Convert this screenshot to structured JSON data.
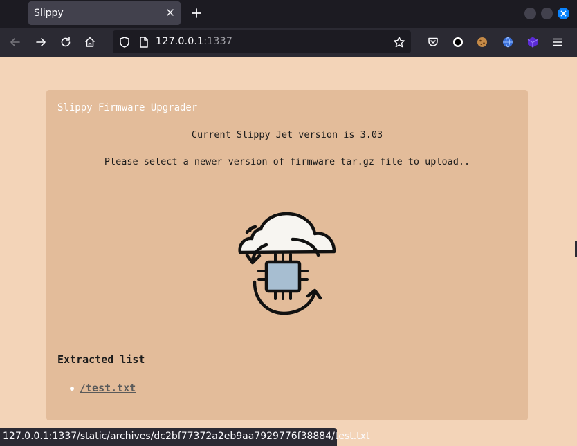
{
  "browser": {
    "tab_title": "Slippy",
    "url_host": "127.0.0.1",
    "url_port": ":1337",
    "status_url": "127.0.0.1:1337/static/archives/dc2bf77372a2eb9aa7929776f38884/test.txt"
  },
  "page": {
    "card_title": "Slippy Firmware Upgrader",
    "current_version_text": "Current Slippy Jet version is 3.03",
    "instruction": "Please select a newer version of firmware tar.gz file to upload..",
    "extracted_heading": "Extracted list",
    "extracted_items": [
      {
        "label": "/test.txt"
      }
    ]
  },
  "icons": {
    "back": "arrow-left-icon",
    "forward": "arrow-right-icon",
    "reload": "reload-icon",
    "home": "home-icon",
    "shield": "shield-icon",
    "page": "page-icon",
    "star": "star-icon",
    "pocket": "pocket-icon",
    "upload": "firmware-upload-icon"
  },
  "colors": {
    "page_bg": "#f3d4b8",
    "card_bg": "#e3bc9a",
    "browser_chrome": "#2b2a33",
    "accent": "#0a84ff"
  }
}
